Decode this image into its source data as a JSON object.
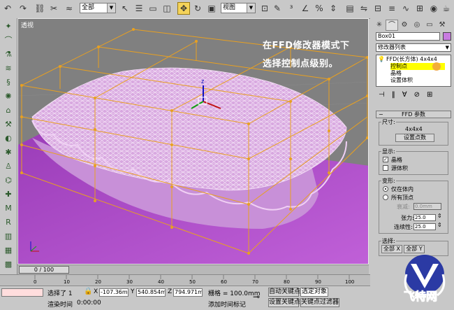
{
  "toolbar": {
    "selection_filter": "全部",
    "ref_coord": "视图"
  },
  "viewport": {
    "label": "透视",
    "note_line1": "在FFD修改器模式下",
    "note_line2": "选择控制点级别。"
  },
  "timeline": {
    "slider": "0 / 100",
    "ticks": [
      "0",
      "10",
      "20",
      "30",
      "40",
      "50",
      "60",
      "70",
      "80",
      "90",
      "100"
    ]
  },
  "status": {
    "selected": "选择了 1",
    "x_label": "X",
    "x_value": "-107.36mm",
    "y_label": "Y",
    "y_value": "540.854mm",
    "z_label": "Z",
    "z_value": "794.971mm",
    "grid": "栅格 = 100.0mm",
    "auto_key": "自动关键点",
    "selected_obj": "选定对象",
    "render_time_label": "渲染时间",
    "render_time": "0:00:00",
    "add_time_tag": "添加时间标记",
    "set_key": "设置关键点",
    "key_filters": "关键点过滤器"
  },
  "panel": {
    "object_name": "Box01",
    "modifier_list": "修改器列表",
    "stack": {
      "ffd": "FFD(长方体) 4x4x4",
      "control_points": "控制点",
      "lattice": "晶格",
      "set_volume": "设置体积"
    },
    "rollout_title": "FFD 参数",
    "dimensions_group": "尺寸:",
    "dims": "4x4x4",
    "set_points_button": "设置点数",
    "display_group": "显示:",
    "lattice_check": "晶格",
    "source_volume_check": "源体积",
    "deform_group": "变形:",
    "only_in_volume": "仅在体内",
    "all_vertices": "所有顶点",
    "falloff_label": "衰减:",
    "falloff_value": "0.0mm",
    "tension_label": "张力:",
    "tension_value": "25.0",
    "continuity_label": "连续性:",
    "continuity_value": "25.0",
    "select_group": "选择:",
    "all_x": "全部 X",
    "all_y": "全部 Y"
  },
  "logo_text": "飞特网",
  "colors": {
    "viewport_bg": "#808080",
    "plane": "#b055c8",
    "lattice": "#e8a020",
    "mesh": "#f0c8f0",
    "highlight": "#ffff00"
  }
}
